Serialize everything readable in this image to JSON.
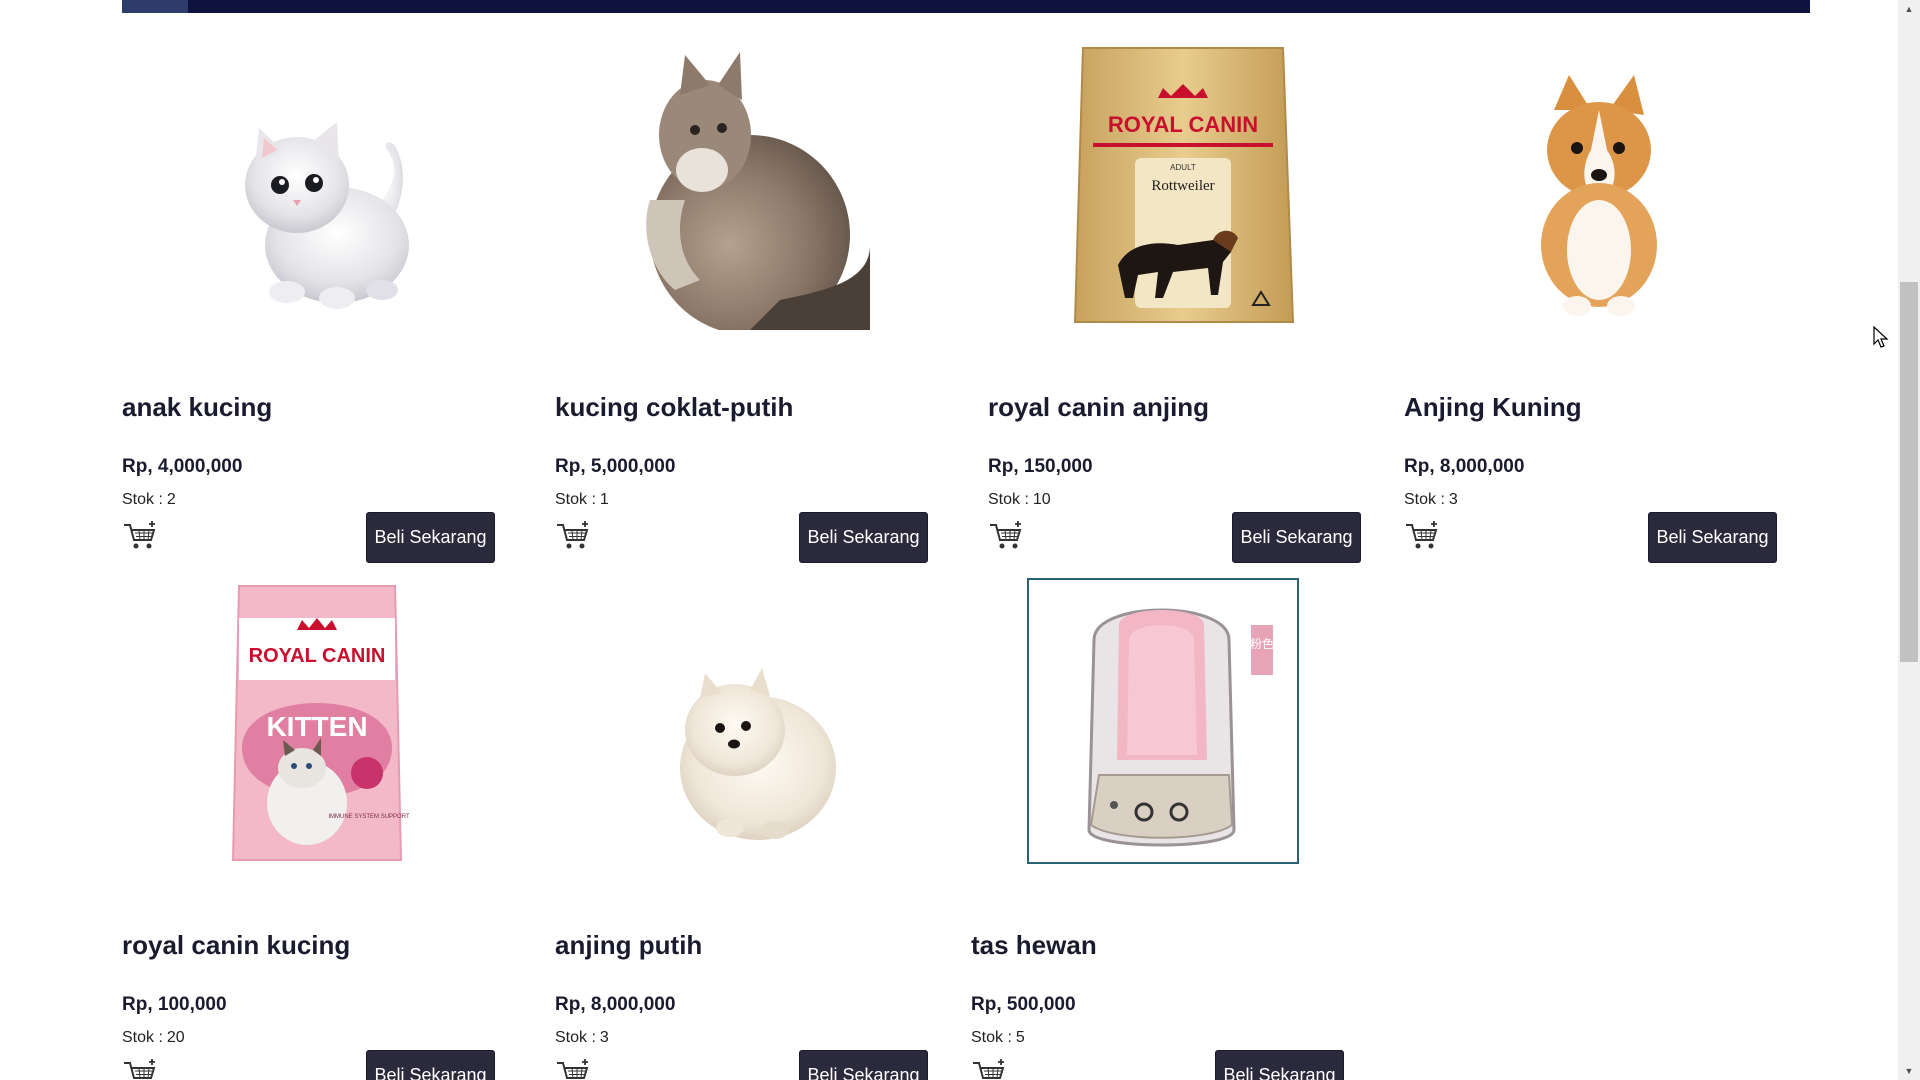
{
  "nav": {
    "bg": "#0e1340",
    "accent": "#2e3d6b"
  },
  "button_color": "#2b2a3d",
  "products": [
    {
      "name": "anak kucing",
      "price": "Rp, 4,000,000",
      "stock_label": "Stok :",
      "stock": "2",
      "buy_label": "Beli Sekarang",
      "image": "white-kitten-image",
      "cart_icon": "add-to-cart-icon"
    },
    {
      "name": "kucing coklat-putih",
      "price": "Rp, 5,000,000",
      "stock_label": "Stok :",
      "stock": "1",
      "buy_label": "Beli Sekarang",
      "image": "brown-white-cat-image",
      "cart_icon": "add-to-cart-icon"
    },
    {
      "name": "royal canin anjing",
      "price": "Rp, 150,000",
      "stock_label": "Stok :",
      "stock": "10",
      "buy_label": "Beli Sekarang",
      "image": "royal-canin-dog-food-bag-image",
      "cart_icon": "add-to-cart-icon"
    },
    {
      "name": "Anjing Kuning",
      "price": "Rp, 8,000,000",
      "stock_label": "Stok :",
      "stock": "3",
      "buy_label": "Beli Sekarang",
      "image": "corgi-puppy-image",
      "cart_icon": "add-to-cart-icon"
    },
    {
      "name": "royal canin kucing",
      "price": "Rp, 100,000",
      "stock_label": "Stok :",
      "stock": "20",
      "buy_label": "Beli Sekarang",
      "image": "royal-canin-kitten-food-bag-image",
      "cart_icon": "add-to-cart-icon"
    },
    {
      "name": "anjing putih",
      "price": "Rp, 8,000,000",
      "stock_label": "Stok :",
      "stock": "3",
      "buy_label": "Beli Sekarang",
      "image": "white-pomeranian-image",
      "cart_icon": "add-to-cart-icon"
    },
    {
      "name": "tas hewan",
      "price": "Rp, 500,000",
      "stock_label": "Stok :",
      "stock": "5",
      "buy_label": "Beli Sekarang",
      "image": "pink-pet-carrier-backpack-image",
      "cart_icon": "add-to-cart-icon"
    }
  ],
  "bag_texts": {
    "brand": "ROYAL CANIN",
    "dog_variant_top": "ADULT",
    "dog_variant": "Rottweiler",
    "cat_variant": "KITTEN",
    "cat_side": "IMMUNE SYSTEM SUPPORT",
    "carrier_tag": "粉色"
  }
}
